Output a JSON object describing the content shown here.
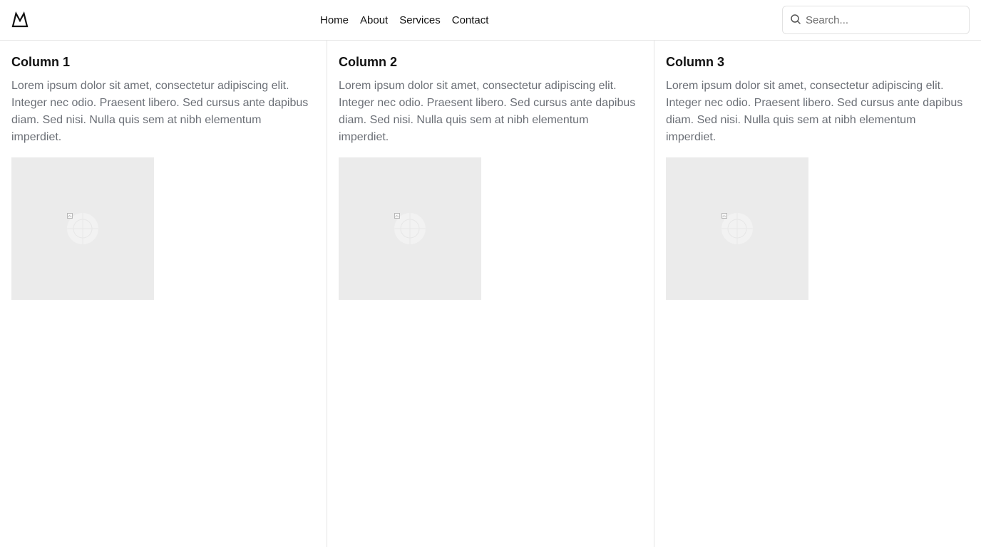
{
  "header": {
    "logo_icon": "mountain-logo-icon",
    "nav": [
      {
        "label": "Home"
      },
      {
        "label": "About"
      },
      {
        "label": "Services"
      },
      {
        "label": "Contact"
      }
    ],
    "search": {
      "placeholder": "Search...",
      "value": "",
      "icon": "search-icon"
    }
  },
  "columns": [
    {
      "title": "Column 1",
      "text": "Lorem ipsum dolor sit amet, consectetur adipiscing elit. Integer nec odio. Praesent libero. Sed cursus ante dapibus diam. Sed nisi. Nulla quis sem at nibh elementum imperdiet.",
      "image_icon": "image-placeholder-icon"
    },
    {
      "title": "Column 2",
      "text": "Lorem ipsum dolor sit amet, consectetur adipiscing elit. Integer nec odio. Praesent libero. Sed cursus ante dapibus diam. Sed nisi. Nulla quis sem at nibh elementum imperdiet.",
      "image_icon": "image-placeholder-icon"
    },
    {
      "title": "Column 3",
      "text": "Lorem ipsum dolor sit amet, consectetur adipiscing elit. Integer nec odio. Praesent libero. Sed cursus ante dapibus diam. Sed nisi. Nulla quis sem at nibh elementum imperdiet.",
      "image_icon": "image-placeholder-icon"
    }
  ],
  "colors": {
    "border": "#e5e5e5",
    "body_text": "#6b6f76",
    "heading_text": "#111111",
    "placeholder_bg": "#ebebeb"
  }
}
